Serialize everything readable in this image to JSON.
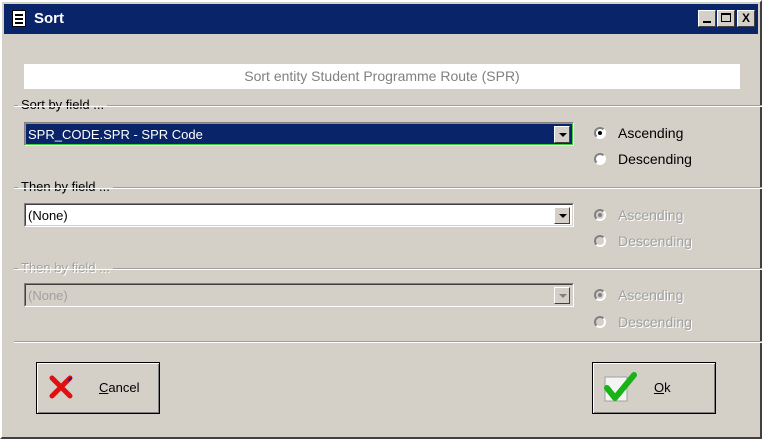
{
  "window": {
    "title": "Sort",
    "minimize_label": "_",
    "maximize_label": "□",
    "close_label": "X"
  },
  "header": {
    "text": "Sort entity Student Programme Route (SPR)"
  },
  "sort_by": {
    "label": "Sort by field ...",
    "value": "SPR_CODE.SPR - SPR Code",
    "ascending_label": "Ascending",
    "descending_label": "Descending",
    "selected_order": "Ascending"
  },
  "then_by_1": {
    "label": "Then by field ...",
    "value": "(None)",
    "ascending_label": "Ascending",
    "descending_label": "Descending",
    "selected_order": "Ascending"
  },
  "then_by_2": {
    "label": "Then by field ...",
    "value": "(None)",
    "ascending_label": "Ascending",
    "descending_label": "Descending",
    "selected_order": "Ascending"
  },
  "buttons": {
    "cancel_mnemonic": "C",
    "cancel_rest": "ancel",
    "ok_mnemonic": "O",
    "ok_rest": "k"
  },
  "colors": {
    "title_bar": "#0a246a",
    "selection": "#0a246a",
    "focus_border": "#3ad13a",
    "cancel_icon": "#e01010",
    "ok_icon": "#19b319"
  },
  "icons": {
    "window": "document-icon",
    "cancel": "red-x-icon",
    "ok": "green-check-icon"
  }
}
